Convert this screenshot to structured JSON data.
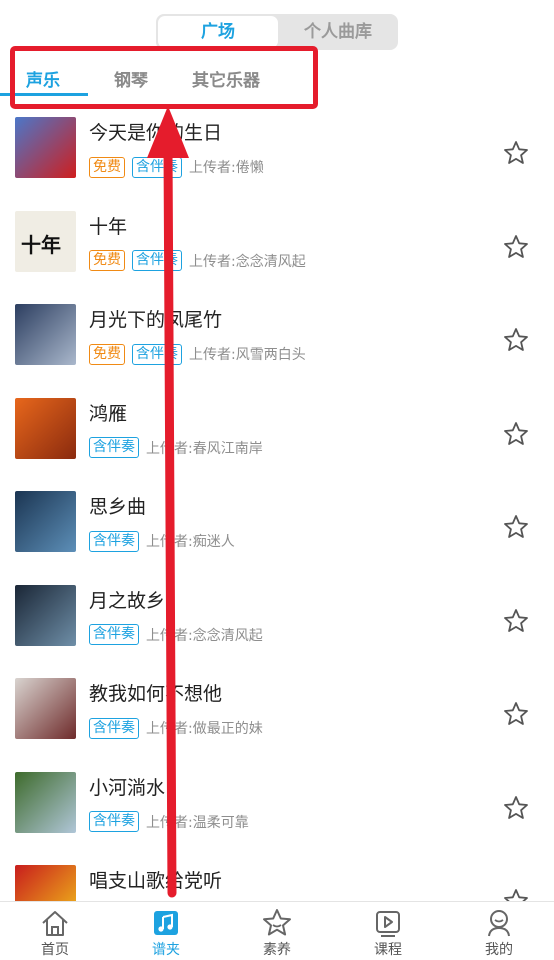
{
  "segment": {
    "active": "广场",
    "inactive": "个人曲库"
  },
  "tabs": [
    "声乐",
    "钢琴",
    "其它乐器"
  ],
  "list": [
    {
      "title": "今天是你的生日",
      "free": true,
      "uploader": "上传者:倦懒",
      "thumb_colors": [
        "#4b77c9",
        "#cf1e1e"
      ]
    },
    {
      "title": "十年",
      "free": true,
      "uploader": "上传者:念念清风起",
      "thumb_colors": [
        "#f0ede4",
        "#1a1a1a"
      ]
    },
    {
      "title": "月光下的凤尾竹",
      "free": true,
      "uploader": "上传者:风雪两白头",
      "thumb_colors": [
        "#2c3e60",
        "#aab8cc"
      ]
    },
    {
      "title": "鸿雁",
      "free": false,
      "uploader": "上传者:春风江南岸",
      "thumb_colors": [
        "#e7671c",
        "#8a2a0e"
      ]
    },
    {
      "title": "思乡曲",
      "free": false,
      "uploader": "上传者:痴迷人",
      "thumb_colors": [
        "#1b3552",
        "#5d8fb8"
      ]
    },
    {
      "title": "月之故乡",
      "free": false,
      "uploader": "上传者:念念清风起",
      "thumb_colors": [
        "#1a2636",
        "#6f8fa8"
      ]
    },
    {
      "title": "教我如何不想他",
      "free": false,
      "uploader": "上传者:做最正的妹",
      "thumb_colors": [
        "#d9d4d0",
        "#6e2a2a"
      ]
    },
    {
      "title": "小河淌水",
      "free": false,
      "uploader": "上传者:温柔可靠",
      "thumb_colors": [
        "#3e6b2c",
        "#b0c6d8"
      ]
    },
    {
      "title": "唱支山歌给党听",
      "free": false,
      "uploader": "",
      "thumb_colors": [
        "#c81d1d",
        "#f2c21a"
      ]
    }
  ],
  "badges": {
    "free": "免费",
    "accompaniment": "含伴奏"
  },
  "thumb_text": {
    "shinian": "十年"
  },
  "nav": [
    "首页",
    "谱夹",
    "素养",
    "课程",
    "我的"
  ],
  "colors": {
    "accent": "#1da2e0",
    "free": "#f08a14",
    "annotation": "#e51c2c"
  }
}
